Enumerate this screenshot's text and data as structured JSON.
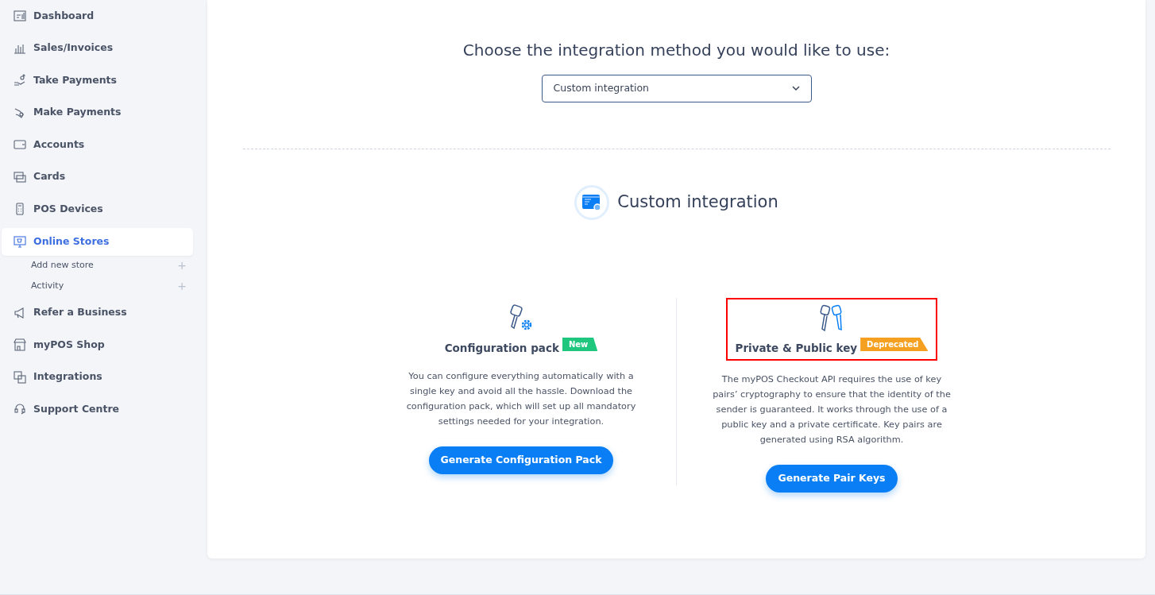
{
  "sidebar": {
    "items": [
      {
        "label": "Dashboard",
        "selected": false
      },
      {
        "label": "Sales/Invoices",
        "selected": false
      },
      {
        "label": "Take Payments",
        "selected": false
      },
      {
        "label": "Make Payments",
        "selected": false
      },
      {
        "label": "Accounts",
        "selected": false
      },
      {
        "label": "Cards",
        "selected": false
      },
      {
        "label": "POS Devices",
        "selected": false
      },
      {
        "label": "Online Stores",
        "selected": true,
        "children": [
          {
            "label": "Add new store",
            "expand": "+"
          },
          {
            "label": "Activity",
            "expand": "+"
          }
        ]
      },
      {
        "label": "Refer a Business",
        "selected": false
      },
      {
        "label": "myPOS Shop",
        "selected": false
      },
      {
        "label": "Integrations",
        "selected": false
      },
      {
        "label": "Support Centre",
        "selected": false
      }
    ]
  },
  "main": {
    "heading": "Choose the integration method you would like to use:",
    "method_select": {
      "value": "Custom integration"
    },
    "section_title": "Custom integration",
    "options": [
      {
        "title": "Configuration pack",
        "badge": {
          "text": "New",
          "color": "#1fc77e"
        },
        "highlighted": false,
        "description": "You can configure everything automatically with a single key and avoid all the hassle. Download the configuration pack, which will set up all mandatory settings needed for your integration.",
        "button": "Generate Configuration Pack"
      },
      {
        "title": "Private & Public key",
        "badge": {
          "text": "Deprecated",
          "color": "#f5a021"
        },
        "highlighted": true,
        "description": "The myPOS Checkout API requires the use of key pairs’ cryptography to ensure that the identity of the sender is guaranteed. It works through the use of a public key and a private certificate. Key pairs are generated using RSA algorithm.",
        "button": "Generate Pair Keys"
      }
    ]
  }
}
